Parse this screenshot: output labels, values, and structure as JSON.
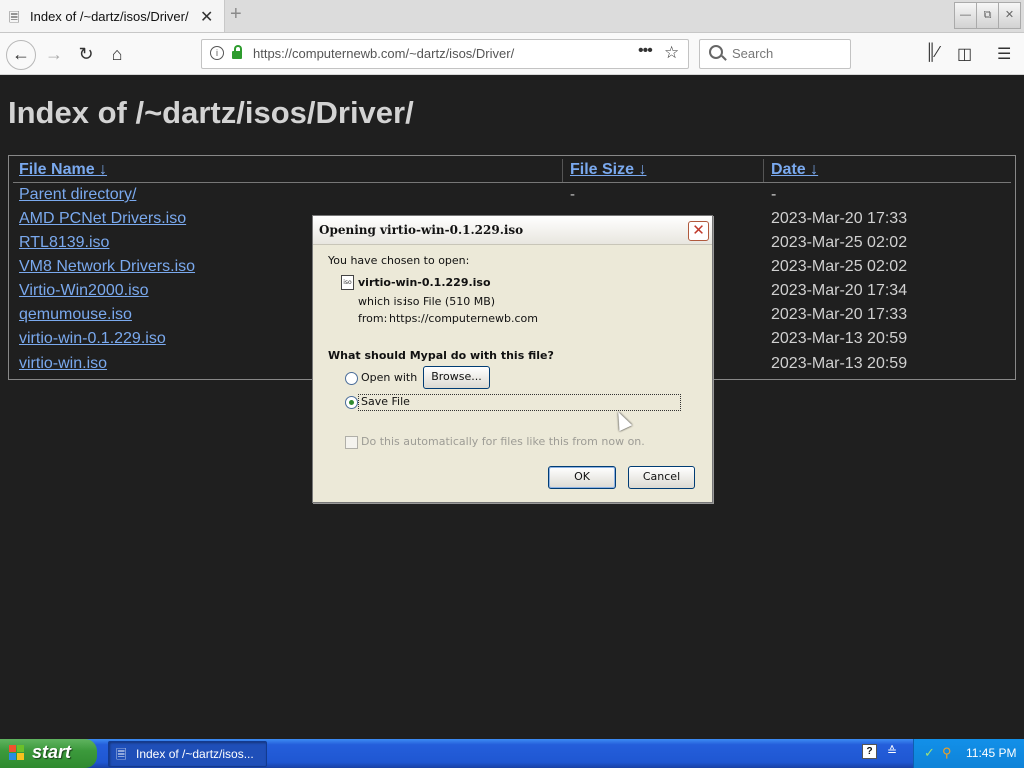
{
  "browser": {
    "tab_title": "Index of /~dartz/isos/Driver/",
    "tab_icon": "generic-page-icon",
    "new_tab": "+",
    "url": "https://computernewb.com/~dartz/isos/Driver/",
    "search_placeholder": "Search"
  },
  "page": {
    "title": "Index of /~dartz/isos/Driver/",
    "headers": {
      "name": "File Name  ↓",
      "size": "File Size  ↓",
      "date": "Date  ↓"
    },
    "rows": [
      {
        "name": "Parent directory/",
        "size": "-",
        "date": "-"
      },
      {
        "name": "AMD PCNet Drivers.iso",
        "size": "",
        "date": "2023-Mar-20 17:33"
      },
      {
        "name": "RTL8139.iso",
        "size": "",
        "date": "2023-Mar-25 02:02"
      },
      {
        "name": "VM8 Network Drivers.iso",
        "size": "",
        "date": "2023-Mar-25 02:02"
      },
      {
        "name": "Virtio-Win2000.iso",
        "size": "",
        "date": "2023-Mar-20 17:34"
      },
      {
        "name": "qemumouse.iso",
        "size": "",
        "date": "2023-Mar-20 17:33"
      },
      {
        "name": "virtio-win-0.1.229.iso",
        "size": "",
        "date": "2023-Mar-13 20:59"
      },
      {
        "name": "virtio-win.iso",
        "size": "",
        "date": "2023-Mar-13 20:59"
      }
    ]
  },
  "dialog": {
    "title": "Opening virtio-win-0.1.229.iso",
    "chosen_text": "You have chosen to open:",
    "file_name": "virtio-win-0.1.229.iso",
    "which_is_label": "which is:",
    "which_is_value": "iso File (510 MB)",
    "from_label": "from:",
    "from_value": "https://computernewb.com",
    "question": "What should Mypal do with this file?",
    "open_with_label": "Open with",
    "browse_label": "Browse...",
    "save_file_label": "Save File",
    "auto_label": "Do this automatically for files like this from now on.",
    "ok_label": "OK",
    "cancel_label": "Cancel",
    "selected_option": "Save File"
  },
  "taskbar": {
    "start_label": "start",
    "task_button_label": "Index of /~dartz/isos...",
    "clock": "11:45 PM"
  }
}
